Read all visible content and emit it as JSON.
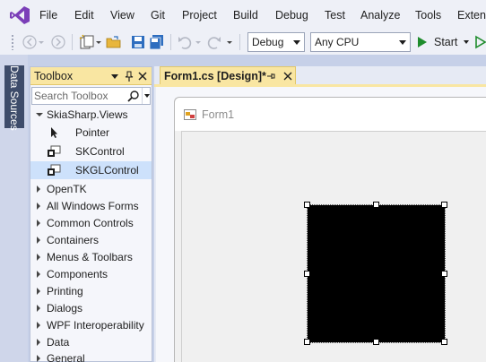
{
  "menu": {
    "items": [
      {
        "label": "File",
        "mnemonic": "F"
      },
      {
        "label": "Edit",
        "mnemonic": "E"
      },
      {
        "label": "View",
        "mnemonic": "V"
      },
      {
        "label": "Git",
        "mnemonic": "G"
      },
      {
        "label": "Project",
        "mnemonic": "P"
      },
      {
        "label": "Build",
        "mnemonic": "B"
      },
      {
        "label": "Debug",
        "mnemonic": "D"
      },
      {
        "label": "Test",
        "mnemonic": "s"
      },
      {
        "label": "Analyze",
        "mnemonic": "N"
      },
      {
        "label": "Tools",
        "mnemonic": "T"
      },
      {
        "label": "Extens",
        "mnemonic": "x"
      }
    ]
  },
  "toolbar": {
    "configuration": "Debug",
    "platform": "Any CPU",
    "start_label": "Start"
  },
  "side_tab": {
    "label": "Data Sources"
  },
  "toolbox": {
    "title": "Toolbox",
    "search_placeholder": "Search Toolbox",
    "group_expanded": "SkiaSharp.Views",
    "items": [
      {
        "label": "Pointer",
        "icon": "pointer-icon",
        "selected": false
      },
      {
        "label": "SKControl",
        "icon": "control-icon",
        "selected": false
      },
      {
        "label": "SKGLControl",
        "icon": "control-icon",
        "selected": true
      }
    ],
    "groups": [
      "OpenTK",
      "All Windows Forms",
      "Common Controls",
      "Containers",
      "Menus & Toolbars",
      "Components",
      "Printing",
      "Dialogs",
      "WPF Interoperability",
      "Data",
      "General"
    ]
  },
  "document": {
    "tab_label": "Form1.cs [Design]*",
    "form_title": "Form1"
  },
  "colors": {
    "accent_tab": "#f9e6a2",
    "vs_purple": "#68217a",
    "control_fill": "#000000",
    "selection": "#cde1fb"
  }
}
